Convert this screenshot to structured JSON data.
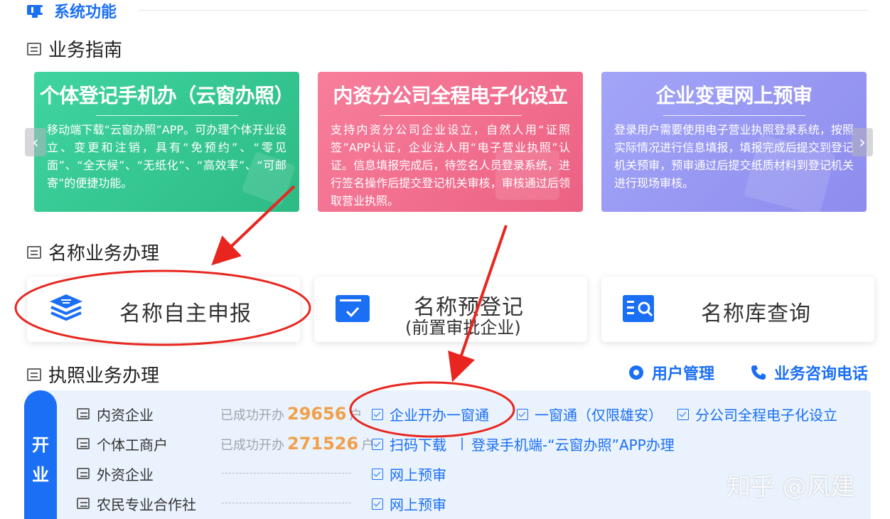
{
  "header": {
    "title": "系统功能"
  },
  "guide": {
    "section_title": "业务指南",
    "cards": [
      {
        "title": "个体登记手机办（云窗办照）",
        "desc": "移动端下载“云窗办照”APP。可办理个体开业设立、变更和注销，具有“免预约”、“零见面”、“全天候”、“无纸化”、“高效率”、“可邮寄”的便捷功能。",
        "color": "#2dbb85"
      },
      {
        "title": "内资分公司全程电子化设立",
        "desc": "支持内资分公司企业设立，自然人用“证照签”APP认证，企业法人用“电子营业执照”认证。信息填报完成后，待签名人员登录系统，进行签名操作后提交登记机关审核，审核通过后领取营业执照。",
        "color": "#ec6183"
      },
      {
        "title": "企业变更网上预审",
        "desc": "登录用户需要使用电子营业执照登录系统，按照实际情况进行信息填报，填报完成后提交到登记机关预审，预审通过后提交纸质材料到登记机关进行现场审核。",
        "color": "#8e8cee"
      }
    ],
    "prev_icon": "‹",
    "next_icon": "›"
  },
  "name_service": {
    "section_title": "名称业务办理",
    "tiles": [
      {
        "label": "名称自主申报",
        "sub": "",
        "icon": "layers-icon"
      },
      {
        "label": "名称预登记",
        "sub": "(前置审批企业)",
        "icon": "card-check-icon"
      },
      {
        "label": "名称库查询",
        "sub": "",
        "icon": "book-search-icon"
      }
    ]
  },
  "license": {
    "section_title": "执照业务办理",
    "user_mgmt": "用户管理",
    "phone": "业务咨询电话",
    "open_tab": [
      "开",
      "业"
    ],
    "rows": [
      {
        "name": "内资企业",
        "stat_prefix": "已成功开办",
        "count": "29656",
        "stat_suffix": "户",
        "links": [
          "企业开办一窗通",
          "一窗通（仅限雄安）",
          "分公司全程电子化设立"
        ]
      },
      {
        "name": "个体工商户",
        "stat_prefix": "已成功开办",
        "count": "271526",
        "stat_suffix": "户",
        "links": [
          "扫码下载",
          "登录手机端-“云窗办照”APP办理"
        ],
        "separator": "|"
      },
      {
        "name": "外资企业",
        "links": [
          "网上预审"
        ]
      },
      {
        "name": "农民专业合作社",
        "links": [
          "网上预审"
        ]
      }
    ]
  },
  "watermark": "知乎 @风建",
  "annotation_color": "#e8261f"
}
